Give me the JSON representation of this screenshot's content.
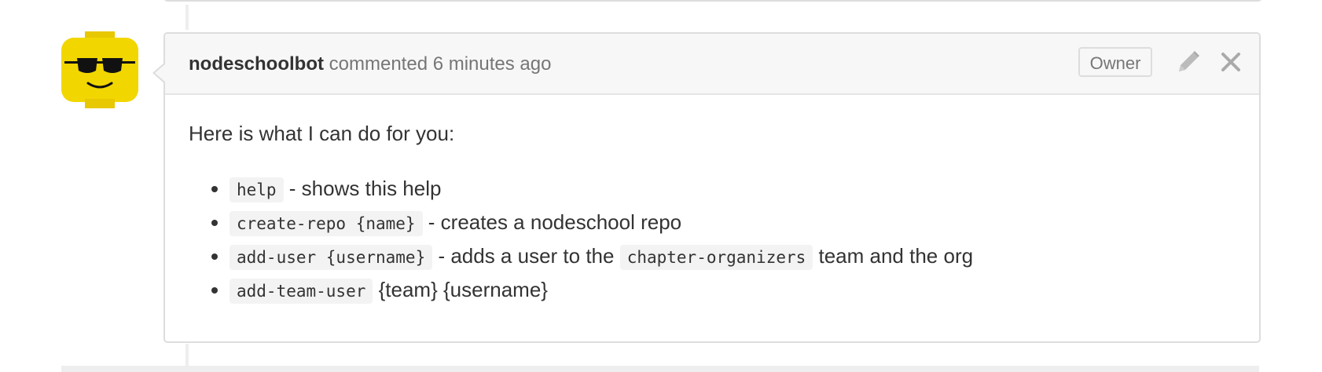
{
  "comment": {
    "author": "nodeschoolbot",
    "action_text": " commented 6 minutes ago",
    "badge": "Owner",
    "icons": {
      "edit": "pencil-icon",
      "close": "close-icon",
      "avatar": "lego-head-sunglasses"
    },
    "intro": "Here is what I can do for you:",
    "commands": [
      {
        "code": "help",
        "desc": " - shows this help"
      },
      {
        "code": "create-repo {name}",
        "desc": " - creates a nodeschool repo"
      },
      {
        "code": "add-user {username}",
        "desc": " - adds a user to the ",
        "code2": "chapter-organizers",
        "desc2": " team and the org"
      },
      {
        "code": "add-team-user",
        "desc": " {team} {username}"
      }
    ]
  },
  "colors": {
    "avatar_yellow": "#f2d600",
    "header_bg": "#f7f7f7",
    "border": "#dddddd",
    "muted_text": "#767676"
  }
}
